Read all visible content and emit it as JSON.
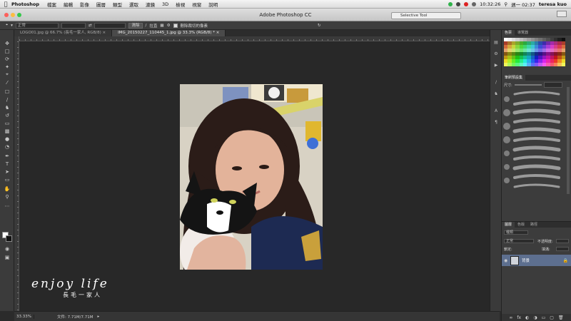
{
  "menubar": {
    "app_name": "Photoshop",
    "items": [
      "檔案",
      "編輯",
      "影像",
      "圖層",
      "類型",
      "選取",
      "濾鏡",
      "3D",
      "檢視",
      "視窗",
      "說明"
    ],
    "clock": "10:32:26",
    "date": "週一 02:37",
    "user": "teresa kuo"
  },
  "titlebar": {
    "title": "Adobe Photoshop CC",
    "selection_popup": "Selective Tool"
  },
  "options": {
    "style_select": "正常",
    "erase_label": "清除",
    "straighten_label": "拉直",
    "delete_cropped_label": "刪除裁切的像素"
  },
  "tabs": [
    {
      "label": "LOGO01.jpg @ 66.7% (長毛一家人, RGB/8) ×"
    },
    {
      "label": "IMG_20150227_110445_1.jpg @ 33.3% (RGB/8) * ×"
    }
  ],
  "status": {
    "zoom": "33.33%",
    "doc": "文件: 7.71M/7.71M"
  },
  "watermark": {
    "line1": "enjoy life",
    "line2": "長毛一家人"
  },
  "panels": {
    "color_tabs": [
      "色票",
      "導覽器"
    ],
    "brush_tabs": [
      "筆刷預設集"
    ],
    "brush_size_label": "尺寸:",
    "layers_tabs": [
      "圖層",
      "色版",
      "路徑"
    ],
    "layer_kind": "種類",
    "blend_mode": "正常",
    "opacity_label": "不透明度:",
    "fill_label": "填滿:",
    "lock_label": "鎖定:",
    "layer_name": "背景"
  },
  "colors": {
    "accent": "#5d6f8f",
    "canvas": "#282828",
    "panel": "#3c3c3c"
  }
}
